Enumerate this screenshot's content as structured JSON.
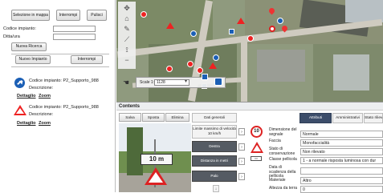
{
  "left_panel": {
    "buttons": {
      "select_on_map": "Selezione in mappa",
      "interrupt": "Interrompi",
      "clear": "Pulisci",
      "new_search": "Nuova Ricerca",
      "new_installation": "Nuovo Impianto",
      "interrupt2": "Interrompi"
    },
    "search_fields": {
      "code_label": "Codice impianto:",
      "code_value": "",
      "company_label": "Ditta/ura",
      "company_value": ""
    },
    "results": [
      {
        "icon": "blue-arrow-sign-icon",
        "code_line": "Codice impianto: P2_Supporto_988",
        "description_label": "Descrizione:",
        "detail_link": "Dettaglio",
        "zoom_link": "Zoom"
      },
      {
        "icon": "warning-triangle-sign-icon",
        "code_line": "Codice impianto: P2_Supporto_988",
        "description_label": "Descrizione:",
        "detail_link": "Dettaglio",
        "zoom_link": "Zoom"
      }
    ]
  },
  "map": {
    "scale_label": "Scale 1:",
    "scale_value": "1128"
  },
  "contents": {
    "title": "Contents",
    "toolbar": {
      "save": "Salva",
      "move": "Sposta",
      "delete": "Elimina"
    },
    "sign_options": [
      {
        "label": "Dati generali",
        "selected": false
      },
      {
        "label": "Limite massimo di velocità 10 km/h",
        "selected": false
      },
      {
        "label": "Destra",
        "selected": true
      },
      {
        "label": "Distanza in metri",
        "selected": true
      },
      {
        "label": "Palo",
        "selected": true
      }
    ],
    "photo_plate_text": "10 m",
    "tabs": {
      "attributes": "Attributi",
      "administrative": "Amministrativi",
      "survey_status": "Stato rilievo"
    },
    "properties": [
      {
        "label": "Dimensione del segnale",
        "value": "Normale"
      },
      {
        "label": "Faccia",
        "value": "Monofaccialità"
      },
      {
        "label": "Stato di conservazione",
        "value": "Non rilevato"
      },
      {
        "label": "Classe pellicola",
        "value": "1 - a normale risposta luminosa con dur"
      },
      {
        "label": "Data di scadenza della pellicola",
        "value": ""
      },
      {
        "label": "Materiale",
        "value": "Altro"
      },
      {
        "label": "Altezza da terra",
        "value": "0"
      }
    ],
    "sign_symbol_text": "10"
  },
  "colors": {
    "active_tab": "#3c4d6a",
    "selected_option": "#555b63",
    "map_background": "#8f9a7e"
  }
}
